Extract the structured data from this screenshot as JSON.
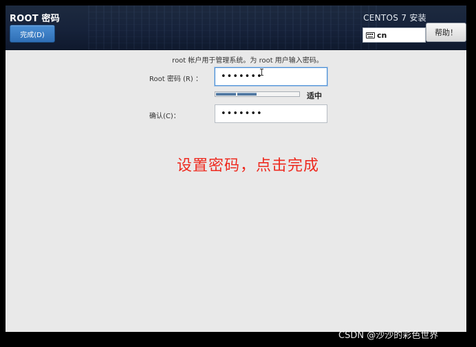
{
  "header": {
    "page_title": "ROOT 密码",
    "done_button": "完成(D)",
    "install_title": "CENTOS 7 安装",
    "language_code": "cn",
    "help_button": "帮助！"
  },
  "form": {
    "intro": "root 帐户用于管理系统。为 root 用户输入密码。",
    "root_password_label": "Root 密码 (R) ：",
    "root_password_masked": "•••••••",
    "strength": {
      "label": "适中",
      "level_fraction": 0.5
    },
    "confirm_label": "确认(C)：",
    "confirm_password_masked": "•••••••"
  },
  "annotation": "设置密码，点击完成",
  "watermark": "CSDN @沙沙的彩色世界",
  "colors": {
    "header_bg": "#16223a",
    "accent_button": "#3a7cc5",
    "annotation_red": "#ee2a1f",
    "body_bg": "#e9e9e9",
    "strength_fill": "#4f7aa6"
  },
  "icons": {
    "keyboard": "keyboard-icon",
    "text_cursor": "text-cursor-icon"
  }
}
